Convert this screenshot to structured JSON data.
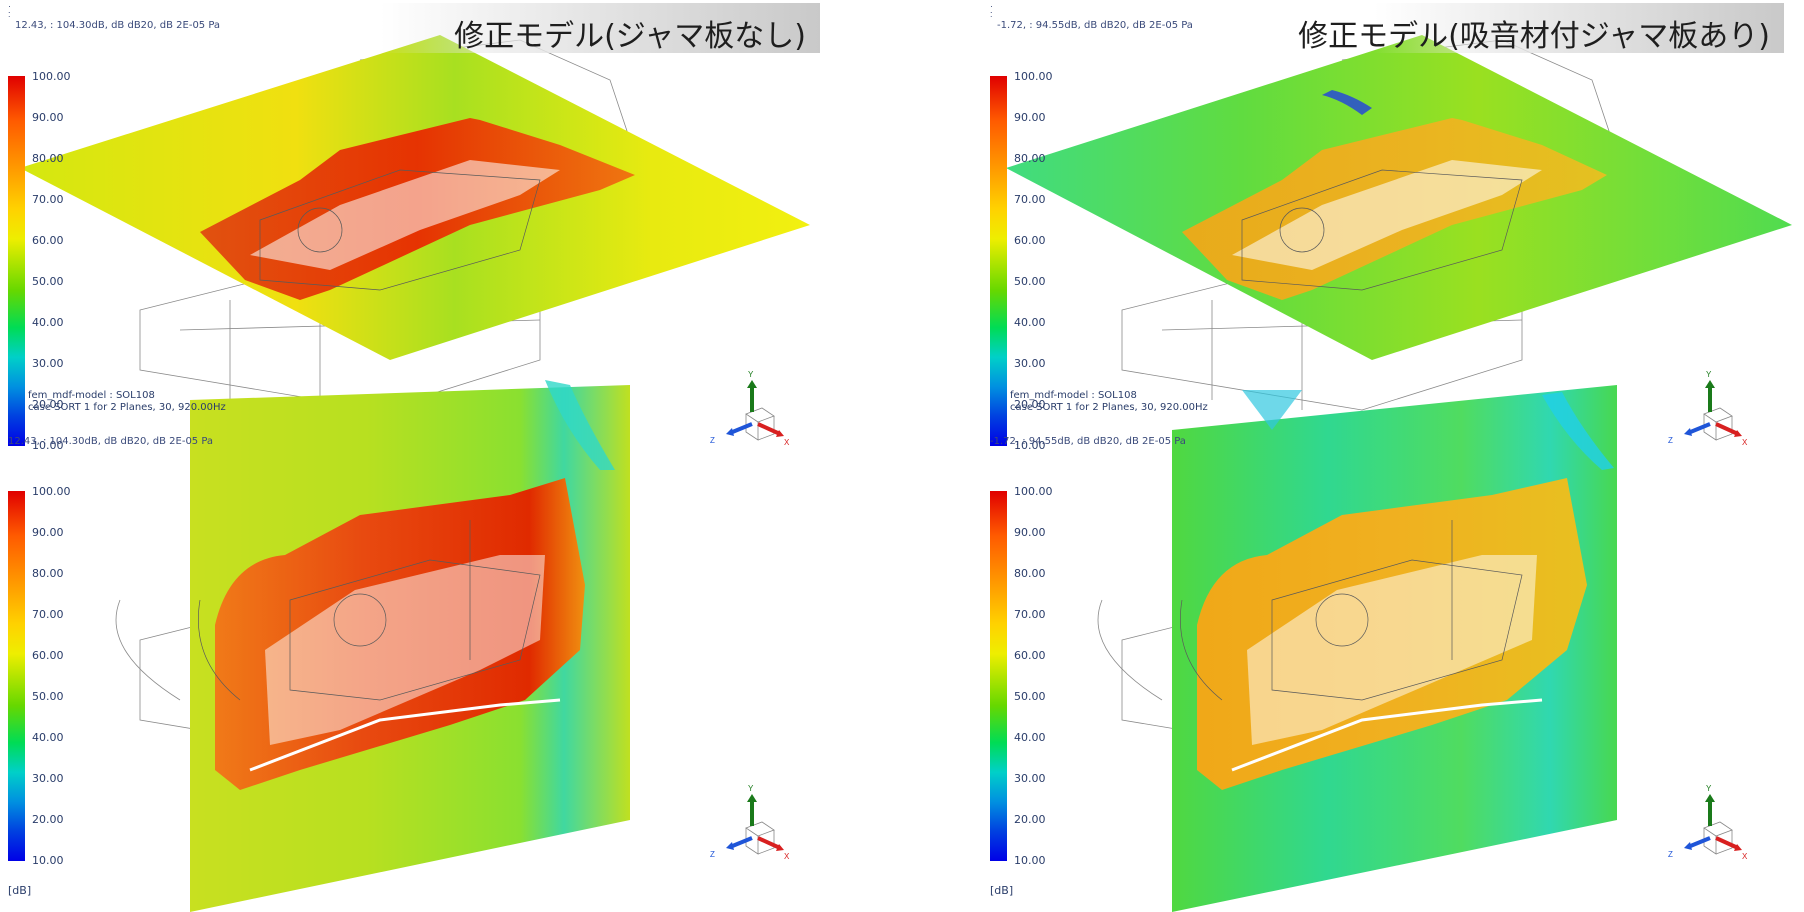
{
  "legend": {
    "ticks": [
      "100.00",
      "90.00",
      "80.00",
      "70.00",
      "60.00",
      "50.00",
      "40.00",
      "30.00",
      "20.00",
      "10.00"
    ],
    "unit": "[dB]"
  },
  "left": {
    "title": "修正モデル(ジャマ板なし)",
    "header_top": "12.43,  : 104.30dB, dB dB20, dB 2E-05 Pa",
    "header_mid": "12.43,  : 104.30dB, dB dB20, dB 2E-05 Pa",
    "info_line1": "fem_mdf-model : SOL108",
    "info_line2": "case  SORT 1 for 2 Planes,  30, 920.00Hz",
    "overlap_value": "20.00"
  },
  "right": {
    "title": "修正モデル(吸音材付ジャマ板あり)",
    "header_top": "-1.72,  : 94.55dB, dB dB20, dB 2E-05 Pa",
    "header_mid": "-1.72,  : 94.55dB, dB dB20, dB 2E-05 Pa",
    "info_line1": "fem_mdf-model : SOL108",
    "info_line2": "case  SORT 1 for 2 Planes,  30, 920.00Hz",
    "overlap_value": "20.00"
  },
  "triad": {
    "y": "Y",
    "z": "Z",
    "x": "X"
  },
  "colors": {
    "hot": "#e02000",
    "orange": "#f08a10",
    "yellow": "#eaea10",
    "green": "#40d040",
    "cyan": "#20d0c0",
    "axis_y": "#1a7a1a",
    "axis_z": "#1f55d8",
    "axis_x": "#d82020"
  }
}
